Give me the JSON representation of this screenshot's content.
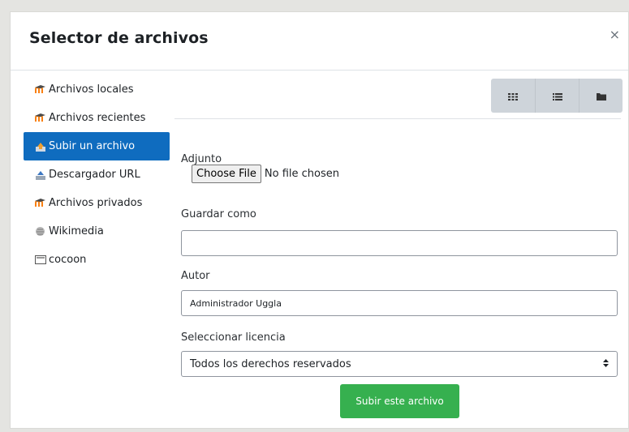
{
  "dialog": {
    "title": "Selector de archivos",
    "close_symbol": "×"
  },
  "sidebar": {
    "items": [
      {
        "label": "Archivos locales",
        "icon": "moodle-icon",
        "active": false
      },
      {
        "label": "Archivos recientes",
        "icon": "moodle-icon",
        "active": true
      },
      {
        "label": "Subir un archivo",
        "icon": "upload-icon",
        "active": true
      },
      {
        "label": "Descargador URL",
        "icon": "url-download-icon",
        "active": false
      },
      {
        "label": "Archivos privados",
        "icon": "moodle-icon",
        "active": false
      },
      {
        "label": "Wikimedia",
        "icon": "wikimedia-icon",
        "active": false
      },
      {
        "label": "cocoon",
        "icon": "cocoon-icon",
        "active": false
      }
    ]
  },
  "toolbar": {
    "views": [
      "grid-view-icon",
      "list-view-icon",
      "folder-view-icon"
    ]
  },
  "form": {
    "attachment_label": "Adjunto",
    "choose_file_label": "Choose File",
    "no_file_text": "No file chosen",
    "save_as_label": "Guardar como",
    "save_as_value": "",
    "author_label": "Autor",
    "author_value": "Administrador Uggla",
    "license_label": "Seleccionar licencia",
    "license_value": "Todos los derechos reservados",
    "submit_label": "Subir este archivo"
  },
  "colors": {
    "active_item": "#0f6cbf",
    "submit_button": "#36b04f",
    "toolbar_button": "#ced4da",
    "moodle_orange": "#f98012"
  }
}
